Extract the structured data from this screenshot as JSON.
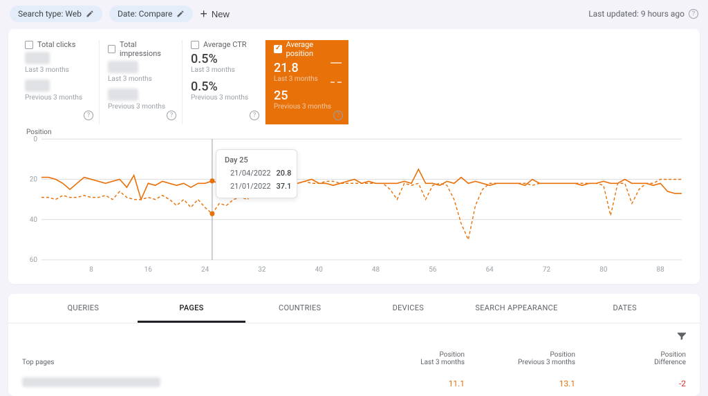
{
  "filters": {
    "search_type": "Search type: Web",
    "date": "Date: Compare",
    "new_label": "New"
  },
  "last_updated": "Last updated: 9 hours ago",
  "metrics": [
    {
      "label": "Total clicks",
      "val1_blur_w": 36,
      "sub1": "Last 3 months",
      "val2_blur_w": 36,
      "sub2": "Previous 3 months",
      "selected": false
    },
    {
      "label": "Total impressions",
      "val1_blur_w": 44,
      "sub1": "Last 3 months",
      "val2_blur_w": 44,
      "sub2": "Previous 3 months",
      "selected": false
    },
    {
      "label": "Average CTR",
      "val1": "0.5%",
      "sub1": "Last 3 months",
      "val2": "0.5%",
      "sub2": "Previous 3 months",
      "selected": false
    },
    {
      "label": "Average position",
      "val1": "21.8",
      "sub1": "Last 3 months",
      "val2": "25",
      "sub2": "Previous 3 months",
      "selected": true
    }
  ],
  "chart_data": {
    "type": "line",
    "title": "Position",
    "y_inverted": true,
    "ylim": [
      0,
      60
    ],
    "yticks": [
      0,
      20,
      40,
      60
    ],
    "xlabel": "",
    "xticks": [
      8,
      16,
      24,
      32,
      40,
      48,
      56,
      64,
      72,
      80,
      88
    ],
    "x": [
      1,
      2,
      3,
      4,
      5,
      6,
      7,
      8,
      9,
      10,
      11,
      12,
      13,
      14,
      15,
      16,
      17,
      18,
      19,
      20,
      21,
      22,
      23,
      24,
      25,
      26,
      27,
      28,
      29,
      30,
      31,
      32,
      33,
      34,
      35,
      36,
      37,
      38,
      39,
      40,
      41,
      42,
      43,
      44,
      45,
      46,
      47,
      48,
      49,
      50,
      51,
      52,
      53,
      54,
      55,
      56,
      57,
      58,
      59,
      60,
      61,
      62,
      63,
      64,
      65,
      66,
      67,
      68,
      69,
      70,
      71,
      72,
      73,
      74,
      75,
      76,
      77,
      78,
      79,
      80,
      81,
      82,
      83,
      84,
      85,
      86,
      87,
      88,
      89,
      90,
      91
    ],
    "series": [
      {
        "name": "Last 3 months",
        "style": "solid",
        "values": [
          19,
          19,
          20,
          22,
          25,
          22,
          19,
          20,
          21,
          22,
          21,
          20,
          24,
          18,
          30,
          22,
          23,
          21,
          22,
          23,
          22,
          24,
          22,
          22,
          20.8,
          22,
          22,
          20,
          21,
          22,
          20,
          20,
          22,
          21,
          22,
          22,
          22,
          21,
          20,
          22,
          22,
          23,
          22,
          21,
          20,
          22,
          21,
          22,
          22,
          22,
          22,
          21,
          22,
          15,
          22,
          22,
          23,
          21,
          22,
          19,
          22,
          21,
          22,
          23,
          22,
          22,
          22,
          22,
          23,
          20,
          22,
          22,
          22,
          22,
          22,
          22,
          23,
          22,
          22,
          21,
          22,
          22,
          20,
          22,
          22,
          22,
          23,
          22,
          26,
          27,
          27
        ]
      },
      {
        "name": "Previous 3 months",
        "style": "dashed",
        "values": [
          29,
          29,
          30,
          28,
          29,
          29,
          28,
          29,
          29,
          28,
          30,
          26,
          29,
          30,
          30,
          29,
          30,
          28,
          30,
          33,
          30,
          34,
          30,
          34,
          37.1,
          32,
          33,
          30,
          29,
          30,
          22,
          22,
          20,
          22,
          21,
          21,
          22,
          21,
          22,
          22,
          21,
          21,
          22,
          22,
          22,
          22,
          22,
          22,
          22,
          25,
          30,
          22,
          23,
          22,
          30,
          23,
          22,
          23,
          30,
          42,
          50,
          33,
          25,
          22,
          22,
          22,
          22,
          22,
          22,
          23,
          22,
          22,
          22,
          22,
          22,
          22,
          22,
          22,
          22,
          23,
          38,
          22,
          22,
          32,
          25,
          22,
          22,
          20,
          20,
          20,
          20
        ]
      }
    ],
    "hover": {
      "index": 25,
      "title": "Day 25",
      "rows": [
        {
          "date": "21/04/2022",
          "value": "20.8",
          "style": "solid"
        },
        {
          "date": "21/01/2022",
          "value": "37.1",
          "style": "dashed"
        }
      ]
    }
  },
  "tabs": [
    "QUERIES",
    "PAGES",
    "COUNTRIES",
    "DEVICES",
    "SEARCH APPEARANCE",
    "DATES"
  ],
  "active_tab": "PAGES",
  "table": {
    "head_left": "Top pages",
    "head_cols": [
      {
        "line1": "Position",
        "line2": "Last 3 months"
      },
      {
        "line1": "Position",
        "line2": "Previous 3 months"
      },
      {
        "line1": "Position",
        "line2": "Difference"
      }
    ],
    "rows": [
      {
        "page_blur": true,
        "c1": "11.1",
        "c2": "13.1",
        "c3": "-2",
        "c3class": "red"
      }
    ]
  }
}
